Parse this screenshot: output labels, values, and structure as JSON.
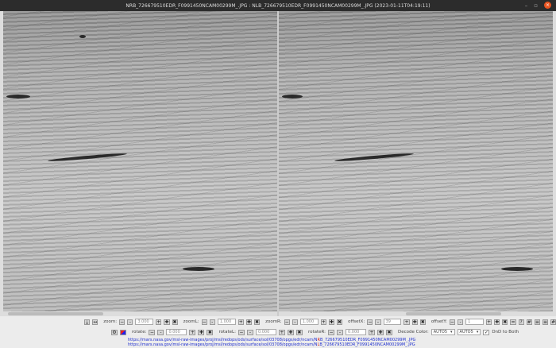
{
  "window": {
    "title": "NRB_726679510EDR_F0991450NCAM00299M_.JPG : NLB_726679510EDR_F0991450NCAM00299M_.JPG (2023-01-11T04:19:11)",
    "minimize": "–",
    "maximize": "▫",
    "close": "×"
  },
  "toolbar1": {
    "zoom_label": "zoom:",
    "zoom_value": "3.000",
    "zoomL_label": "zoomL:",
    "zoomL_value": "1.000",
    "zoomR_label": "zoomR:",
    "zoomR_value": "1.000",
    "offsetX_label": "offsetX:",
    "offsetX_value": "39",
    "offsetY_label": "offsetY:",
    "offsetY_value": "1"
  },
  "toolbar2": {
    "rotate_label": "rotate:",
    "rotate_value": "0.000",
    "rotateL_label": "rotateL:",
    "rotateL_value": "0.000",
    "rotateR_label": "rotateR:",
    "rotateR_value": "0.000",
    "decode_label": "Decode Color:",
    "decode_left": "AUTO5",
    "decode_right": "AUTO5",
    "dnd_label": "DnD to Both",
    "dnd_checked": true
  },
  "urls": [
    {
      "prefix": "https://mars.nasa.gov/msl-raw-images/proj/msl/redops/ods/surface/sol/03708/opgs/edr/ncam/N",
      "hl": "R",
      "suffix": "B_726679510EDR_F0991450NCAM00299M_.JPG"
    },
    {
      "prefix": "https://mars.nasa.gov/msl-raw-images/proj/msl/redops/ods/surface/sol/03708/opgs/edr/ncam/N",
      "hl": "L",
      "suffix": "B_726679510EDR_F0991450NCAM00299M_.JPG"
    }
  ]
}
